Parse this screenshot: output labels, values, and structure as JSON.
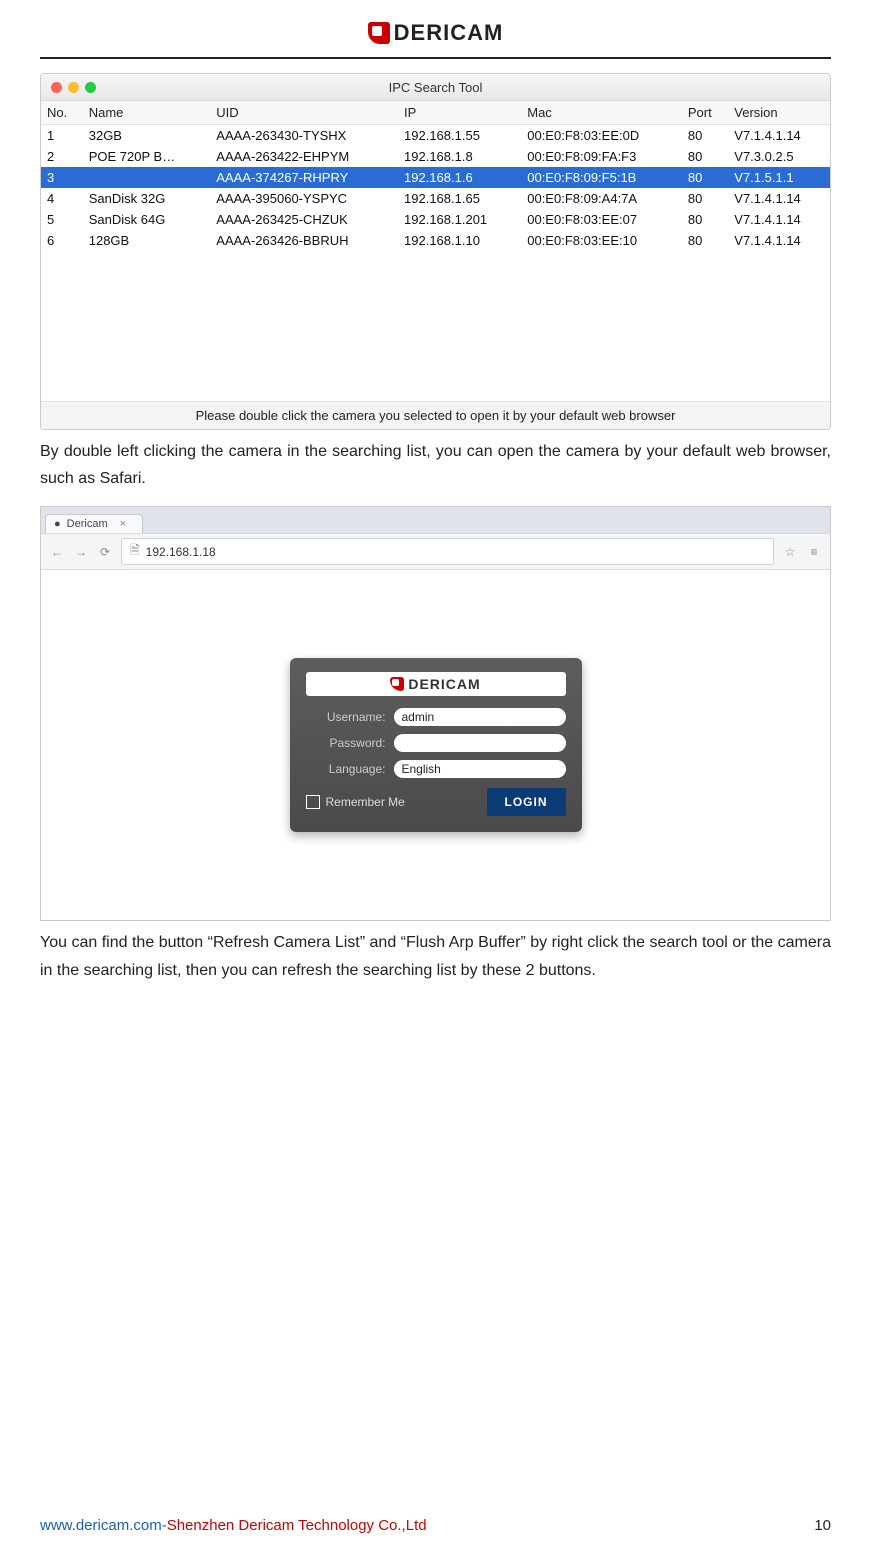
{
  "header": {
    "brand": "DERICAM"
  },
  "ipc": {
    "window_title": "IPC Search Tool",
    "columns": [
      "No.",
      "Name",
      "UID",
      "IP",
      "Mac",
      "Port",
      "Version"
    ],
    "rows": [
      {
        "no": "1",
        "name": "32GB",
        "uid": "AAAA-263430-TYSHX",
        "ip": "192.168.1.55",
        "mac": "00:E0:F8:03:EE:0D",
        "port": "80",
        "ver": "V7.1.4.1.14",
        "selected": false
      },
      {
        "no": "2",
        "name": "POE 720P B…",
        "uid": "AAAA-263422-EHPYM",
        "ip": "192.168.1.8",
        "mac": "00:E0:F8:09:FA:F3",
        "port": "80",
        "ver": "V7.3.0.2.5",
        "selected": false
      },
      {
        "no": "3",
        "name": "",
        "uid": "AAAA-374267-RHPRY",
        "ip": "192.168.1.6",
        "mac": "00:E0:F8:09:F5:1B",
        "port": "80",
        "ver": "V7.1.5.1.1",
        "selected": true
      },
      {
        "no": "4",
        "name": "SanDisk 32G",
        "uid": "AAAA-395060-YSPYC",
        "ip": "192.168.1.65",
        "mac": "00:E0:F8:09:A4:7A",
        "port": "80",
        "ver": "V7.1.4.1.14",
        "selected": false
      },
      {
        "no": "5",
        "name": "SanDisk 64G",
        "uid": "AAAA-263425-CHZUK",
        "ip": "192.168.1.201",
        "mac": "00:E0:F8:03:EE:07",
        "port": "80",
        "ver": "V7.1.4.1.14",
        "selected": false
      },
      {
        "no": "6",
        "name": "128GB",
        "uid": "AAAA-263426-BBRUH",
        "ip": "192.168.1.10",
        "mac": "00:E0:F8:03:EE:10",
        "port": "80",
        "ver": "V7.1.4.1.14",
        "selected": false
      }
    ],
    "hint": "Please double click the camera you selected to open it by your default web browser"
  },
  "para1": "By double left clicking the camera in the searching list, you can open the camera by your default web browser, such as Safari.",
  "browser": {
    "tab_title": "Dericam",
    "url": "192.168.1.18"
  },
  "login": {
    "brand": "DERICAM",
    "username_label": "Username:",
    "username_value": "admin",
    "password_label": "Password:",
    "password_value": "",
    "language_label": "Language:",
    "language_value": "English",
    "remember_label": "Remember Me",
    "login_button": "LOGIN"
  },
  "para2": "You can find the button “Refresh Camera List” and “Flush Arp Buffer” by right click the search tool or the camera in the searching list, then you can refresh the searching list by these 2 buttons.",
  "footer": {
    "site": "www.dericam.com",
    "sep": "-",
    "company": "Shenzhen Dericam Technology Co.,Ltd",
    "page": "10"
  }
}
